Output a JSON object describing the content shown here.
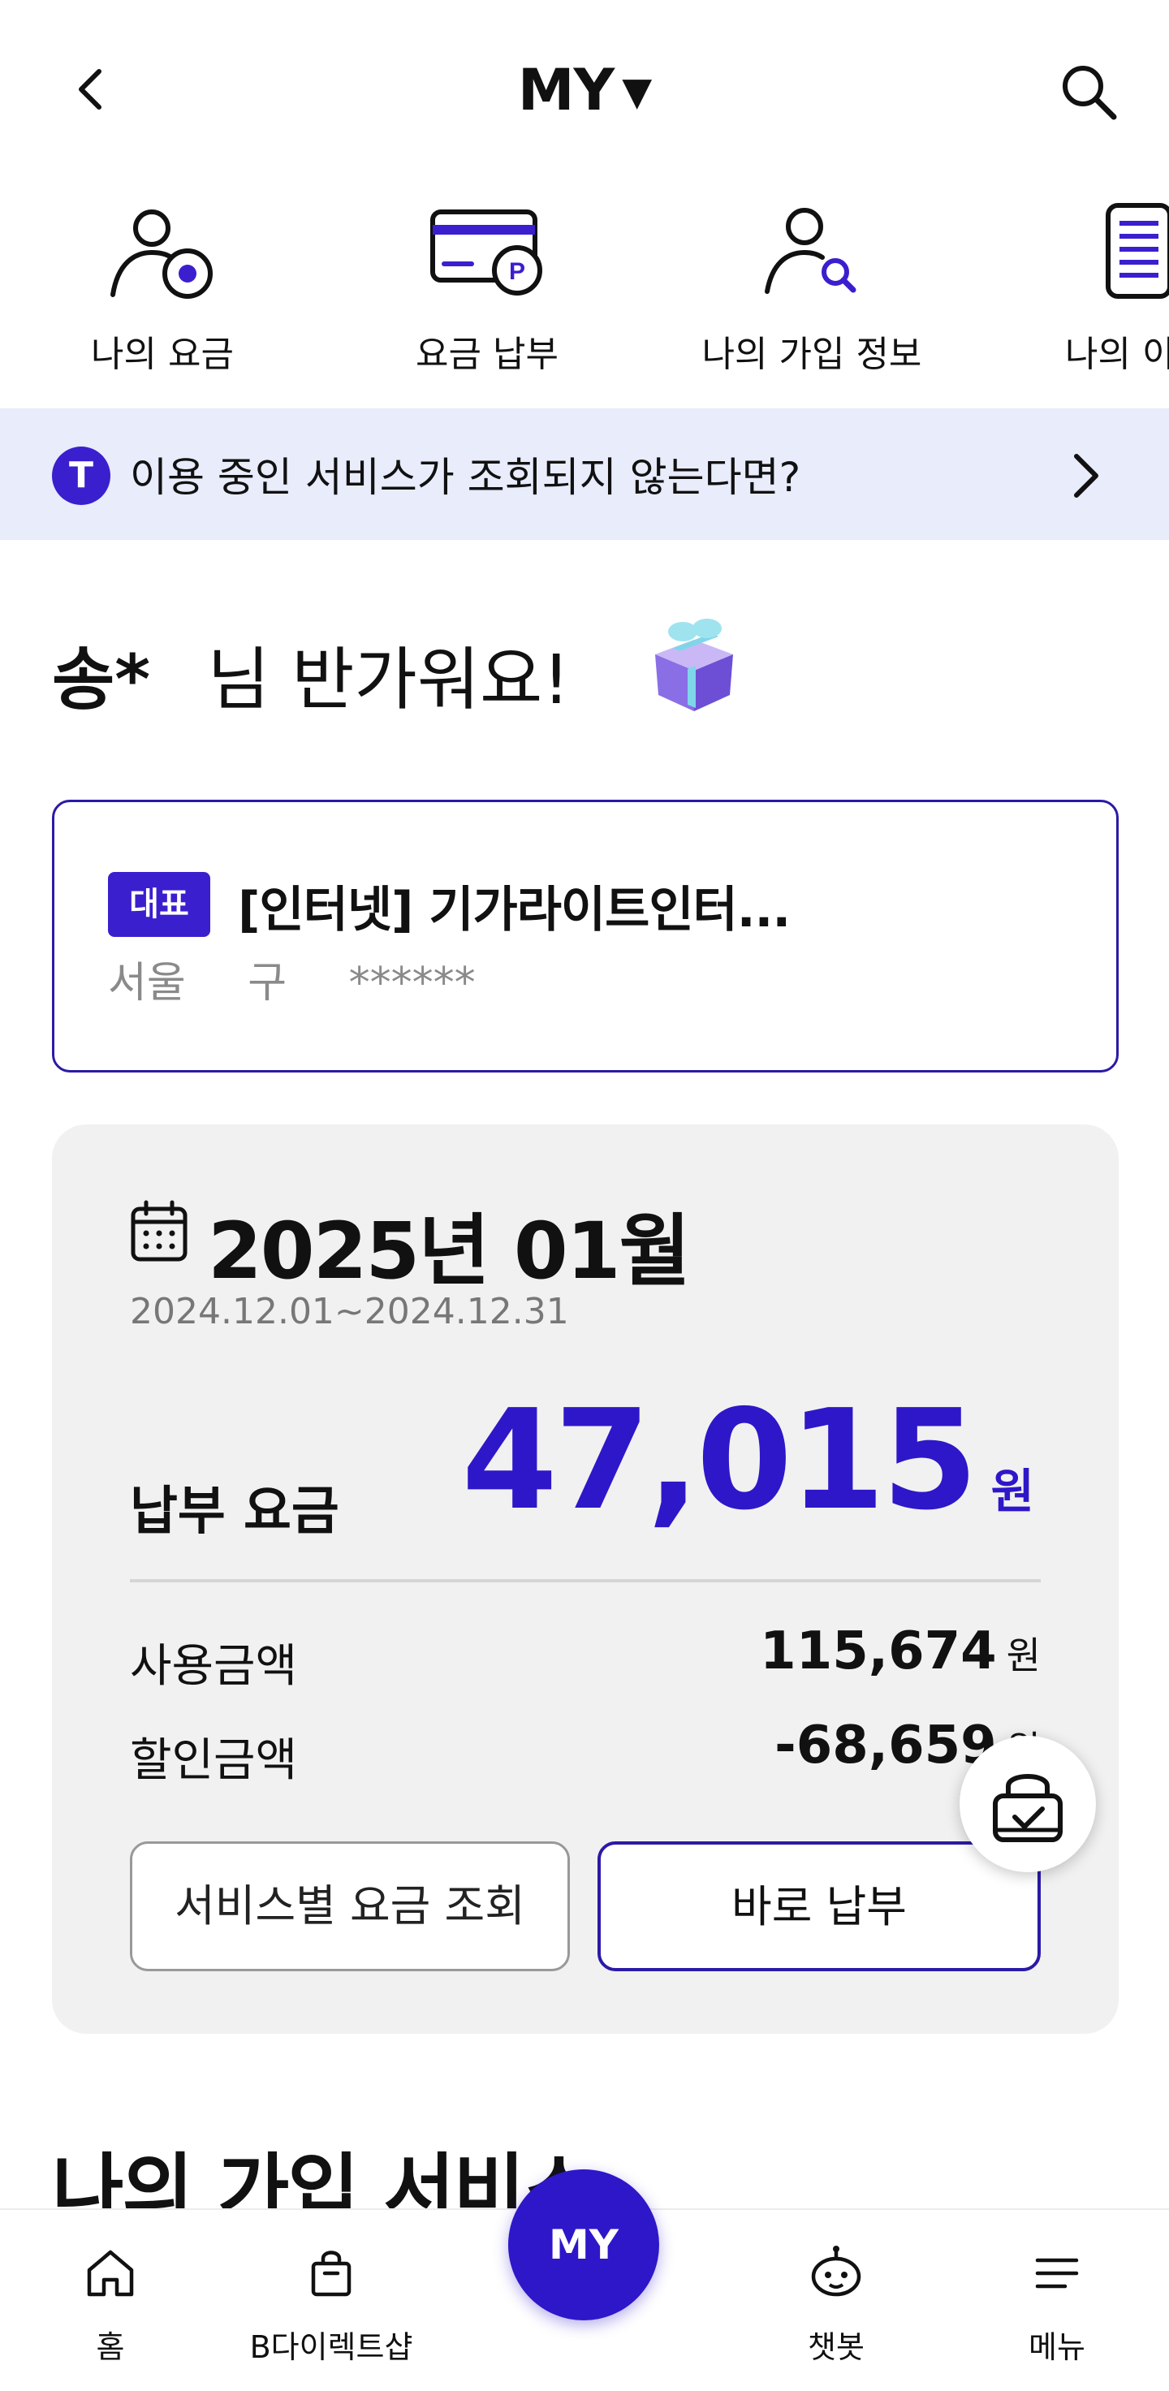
{
  "header": {
    "title": "MY",
    "title_caret": "▼"
  },
  "quick_menu": [
    {
      "label": "나의 요금",
      "icon": "user-coin-icon"
    },
    {
      "label": "요금 납부",
      "icon": "card-point-icon"
    },
    {
      "label": "나의 가입 정보",
      "icon": "user-search-icon"
    },
    {
      "label": "나의 이용",
      "icon": "document-list-icon"
    }
  ],
  "notice": {
    "badge": "T",
    "text": "이용 중인 서비스가 조회되지 않는다면?"
  },
  "greeting": {
    "name": "송*",
    "message": "님 반가워요!"
  },
  "service_card": {
    "tag": "대표",
    "name": "[인터넷] 기가라이트인터...",
    "address": "서울 구 ******"
  },
  "bill": {
    "month": "2025년 01월",
    "period": "2024.12.01~2024.12.31",
    "pay_label": "납부 요금",
    "pay_amount": "47,015",
    "currency": "원",
    "usage_label": "사용금액",
    "usage_amount": "115,674",
    "discount_label": "할인금액",
    "discount_amount": "-68,659",
    "btn_by_service": "서비스별 요금 조회",
    "btn_pay_now": "바로 납부"
  },
  "section": {
    "title": "나의 가입 서비스"
  },
  "bottom_nav": {
    "home": "홈",
    "shop": "B다이렉트샵",
    "my": "MY",
    "chatbot": "챗봇",
    "menu": "메뉴"
  },
  "colors": {
    "brand": "#2e17c9",
    "notice_bg": "#e8ecfb",
    "card_bg": "#f1f1f1"
  }
}
